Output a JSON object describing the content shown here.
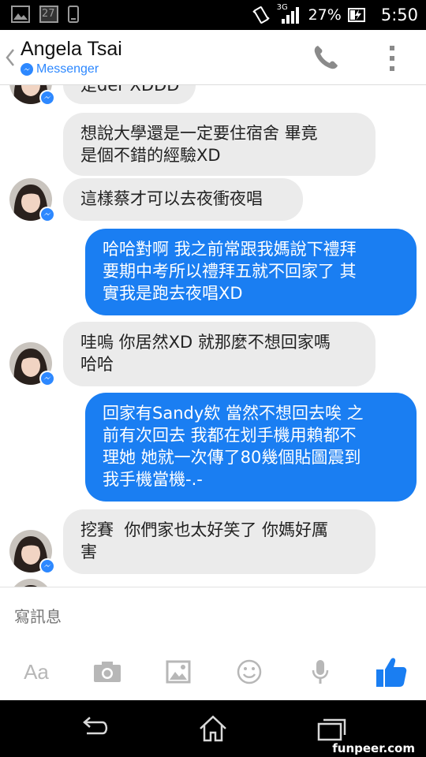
{
  "status_bar": {
    "notification_badge": "27",
    "network": "3G",
    "battery": "27%",
    "time": "5:50"
  },
  "header": {
    "contact_name": "Angela Tsai",
    "app_label": "Messenger"
  },
  "messages": [
    {
      "from": "contact",
      "text": "是der XDDD"
    },
    {
      "from": "contact",
      "lines": [
        "想說大學還是一定要住宿舍 畢竟",
        "是個不錯的經驗XD"
      ]
    },
    {
      "from": "contact",
      "text": "這樣蔡才可以去夜衝夜唱"
    },
    {
      "from": "me",
      "lines": [
        "哈哈對啊 我之前常跟我媽說下禮拜",
        "要期中考所以禮拜五就不回家了 其",
        "實我是跑去夜唱XD"
      ]
    },
    {
      "from": "contact",
      "lines": [
        "哇嗚 你居然XD 就那麼不想回家嗎",
        "哈哈"
      ]
    },
    {
      "from": "me",
      "lines": [
        "回家有Sandy欸 當然不想回去唉 之",
        "前有次回去 我都在划手機用賴都不",
        "理她 她就一次傳了80幾個貼圖震到",
        "我手機當機-.-"
      ]
    },
    {
      "from": "contact",
      "lines": [
        "挖賽  你們家也太好笑了 你媽好厲",
        "害"
      ]
    }
  ],
  "compose": {
    "placeholder": "寫訊息",
    "aa_label": "Aa"
  },
  "watermark": "funpeer.com",
  "colors": {
    "accent": "#1a7ef2",
    "incoming_bubble": "#ebebeb",
    "like_button": "#1a7ef2"
  }
}
